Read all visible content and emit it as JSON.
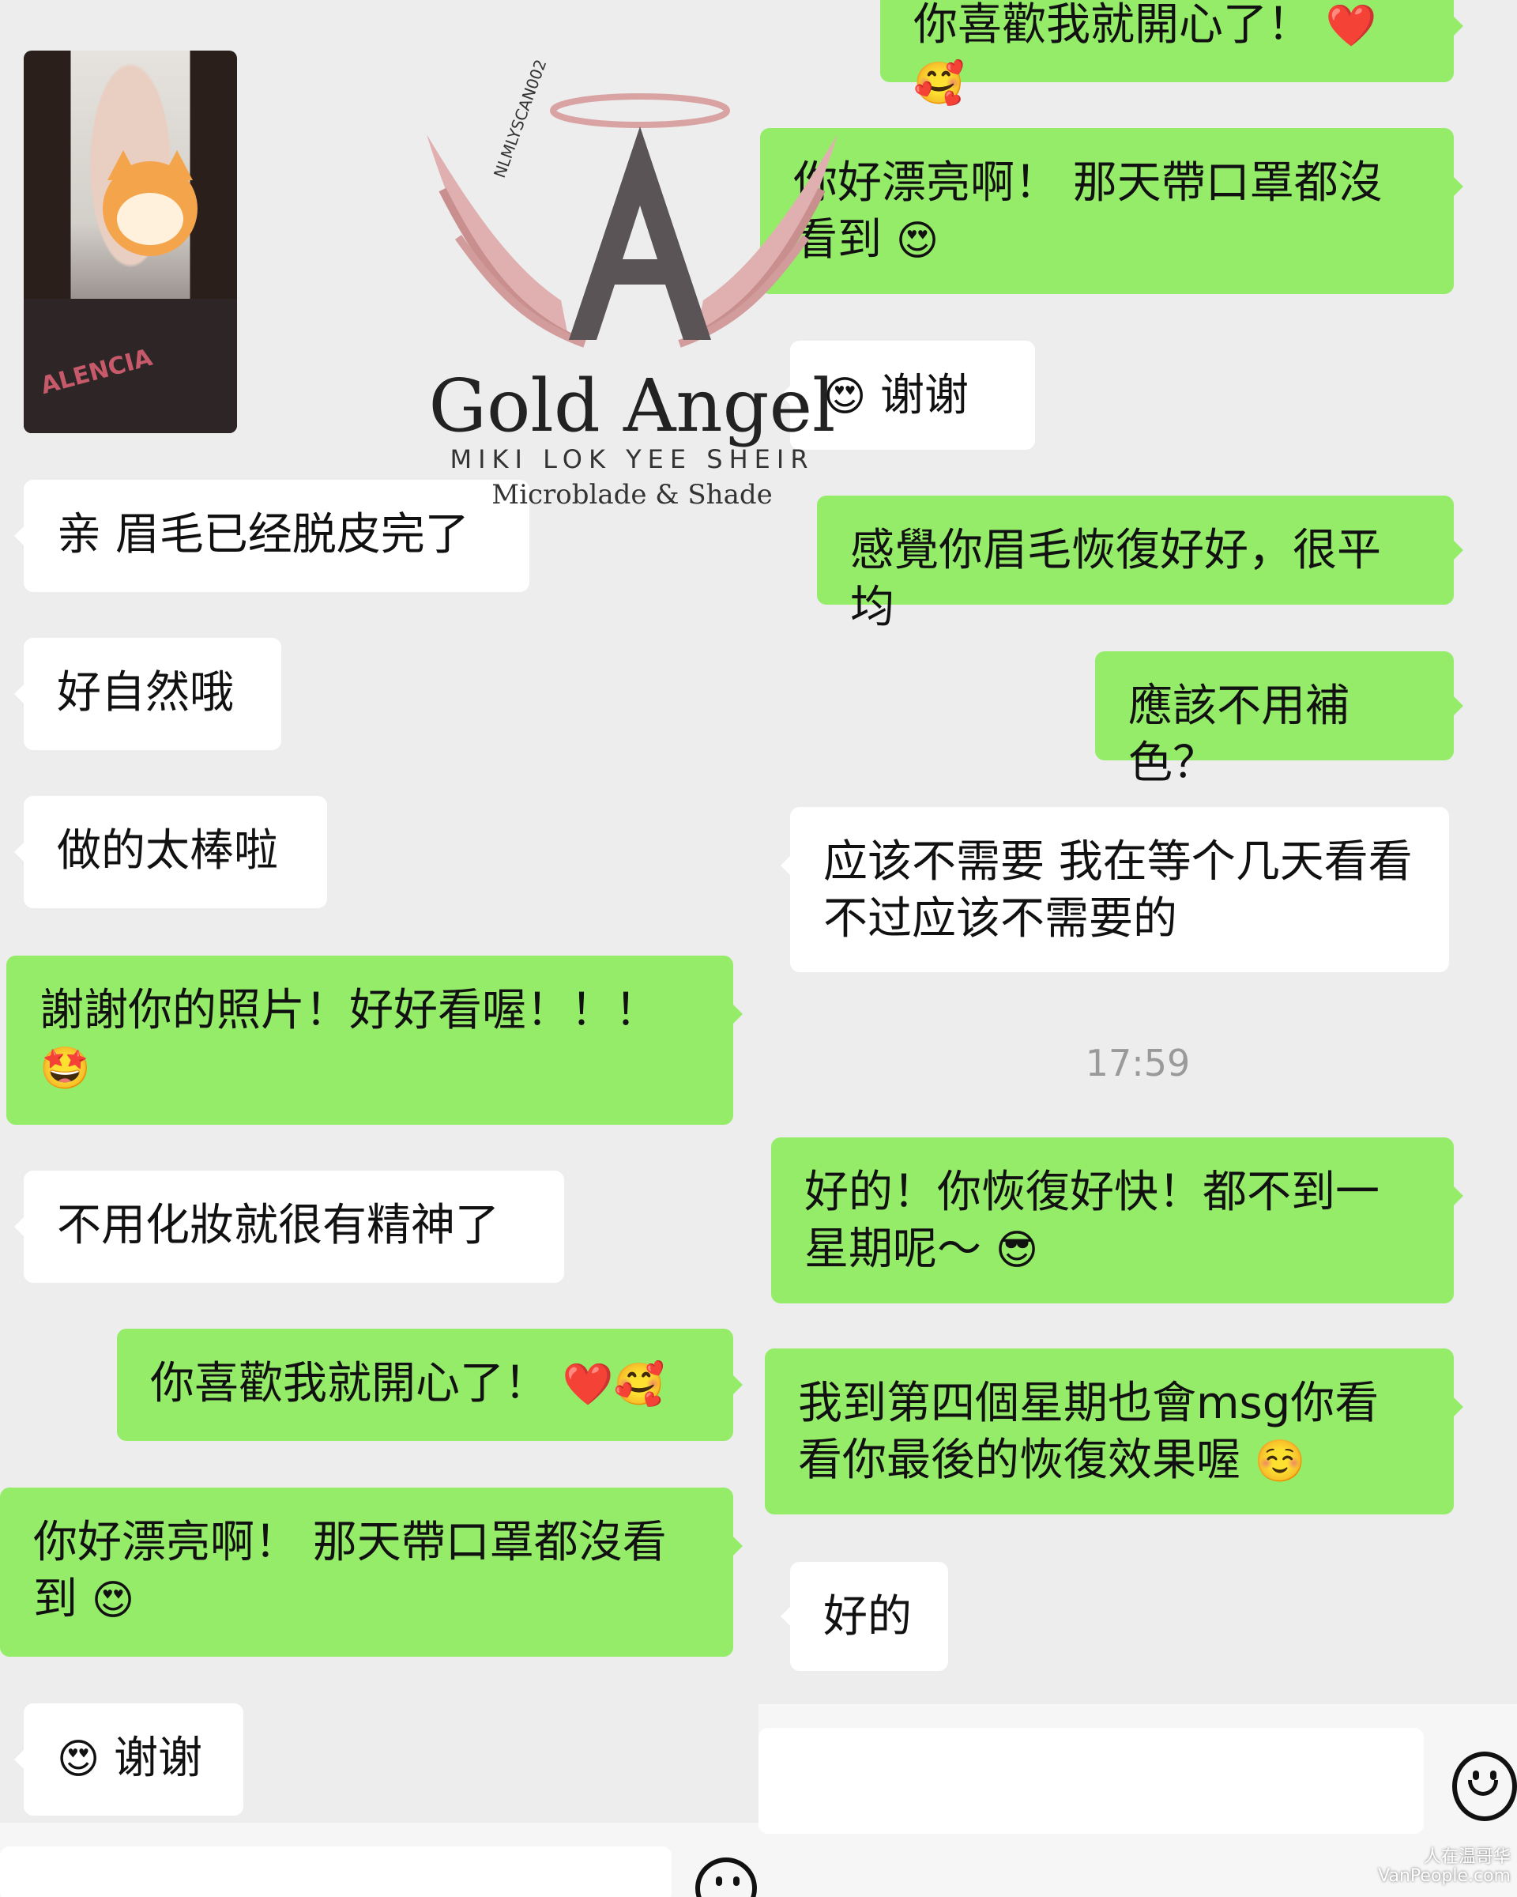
{
  "left": {
    "messages": [
      {
        "text": "亲 眉毛已经脱皮完了"
      },
      {
        "text": "好自然哦"
      },
      {
        "text": "做的太棒啦"
      },
      {
        "text": "謝謝你的照片！好好看喔！！！",
        "emoji": "🤩"
      },
      {
        "text": "不用化妝就很有精神了"
      },
      {
        "text": "你喜歡我就開心了！",
        "emoji": "❤️🥰"
      },
      {
        "text": "你好漂亮啊！ 那天帶口罩都沒看到",
        "emoji": "😍"
      },
      {
        "text": "谢谢",
        "emoji": "😍"
      }
    ],
    "photo": {
      "sweater_text": "ALENCIA"
    }
  },
  "right": {
    "messages": [
      {
        "text": "你喜歡我就開心了！",
        "emoji": "❤️🥰"
      },
      {
        "text": "你好漂亮啊！ 那天帶口罩都沒看到",
        "emoji": "😍"
      },
      {
        "text": "谢谢",
        "emoji": "😍"
      },
      {
        "text": "感覺你眉毛恢復好好，很平均"
      },
      {
        "text": "應該不用補色？"
      },
      {
        "text": "应该不需要 我在等个几天看看\n不过应该不需要的"
      },
      {
        "text": "好的！你恢復好快！都不到一星期呢～",
        "emoji": "😎"
      },
      {
        "text": "我到第四個星期也會msg你看看你最後的恢復效果喔",
        "emoji": "☺️"
      },
      {
        "text": "好的"
      }
    ],
    "timestamp": "17:59"
  },
  "watermark": {
    "title": "Gold Angel",
    "subtitle": "MIKI LOK YEE SHEIR",
    "tagline": "Microblade & Shade",
    "code": "NLMLYSCAN002"
  },
  "corner_mark": {
    "line1": "人在温哥华",
    "line2": "VanPeople.com"
  }
}
